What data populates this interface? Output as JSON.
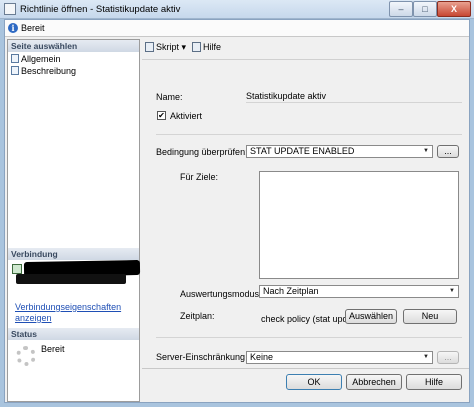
{
  "window": {
    "title": "Richtlinie öffnen - Statistikupdate aktiv",
    "min": "–",
    "max": "□",
    "close": "X"
  },
  "infobar": {
    "icon": "info-icon",
    "status": "Bereit"
  },
  "left": {
    "select_page_header": "Seite auswählen",
    "pages": [
      "Allgemein",
      "Beschreibung"
    ],
    "connection_header": "Verbindung",
    "connection_link_1": "Verbindungseigenschaften",
    "connection_link_2": "anzeigen",
    "status_header": "Status",
    "status_text": "Bereit"
  },
  "toolbar": {
    "script_label": "Skript",
    "script_arrow": "▾",
    "help_label": "Hilfe"
  },
  "form": {
    "name_label": "Name:",
    "name_value": "Statistikupdate aktiv",
    "enabled_label": "Aktiviert",
    "enabled_checked": "✔",
    "condition_label": "Bedingung überprüfen:",
    "condition_value": "STAT UPDATE ENABLED",
    "condition_more": "...",
    "targets_label": "Für Ziele:",
    "eval_mode_label": "Auswertungsmodus:",
    "eval_mode_value": "Nach Zeitplan",
    "schedule_label": "Zeitplan:",
    "schedule_value": "check policy (stat upd",
    "choose_button": "Auswählen",
    "new_button": "Neu",
    "server_restriction_label": "Server-Einschränkung",
    "server_restriction_value": "Keine",
    "server_restriction_more": "..."
  },
  "footer": {
    "ok": "OK",
    "cancel": "Abbrechen",
    "help": "Hilfe"
  }
}
